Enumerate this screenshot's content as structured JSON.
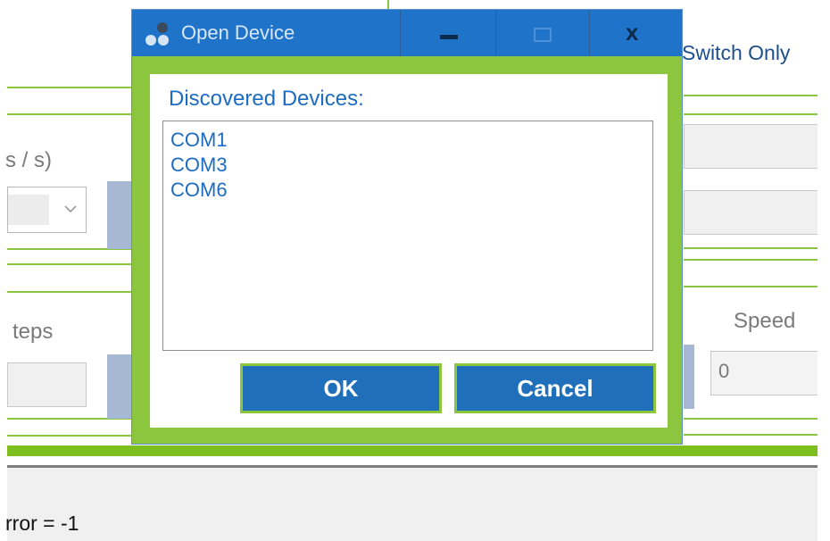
{
  "background": {
    "switch_label": "Switch Only",
    "units_label": "s / s)",
    "steps_label": "teps",
    "speed_label": "Speed",
    "speed_value": "0",
    "status_text": "rror = -1"
  },
  "dialog": {
    "title": "Open Device",
    "minimize_glyph": "—",
    "maximize_glyph": "□",
    "close_glyph": "x",
    "discovered_label": "Discovered Devices:",
    "devices": [
      "COM1",
      "COM3",
      "COM6"
    ],
    "ok_label": "OK",
    "cancel_label": "Cancel"
  },
  "colors": {
    "accent_green": "#8cc63f",
    "title_blue": "#1f74c9",
    "button_blue": "#1f6fba",
    "text_blue": "#1d6cc4"
  }
}
